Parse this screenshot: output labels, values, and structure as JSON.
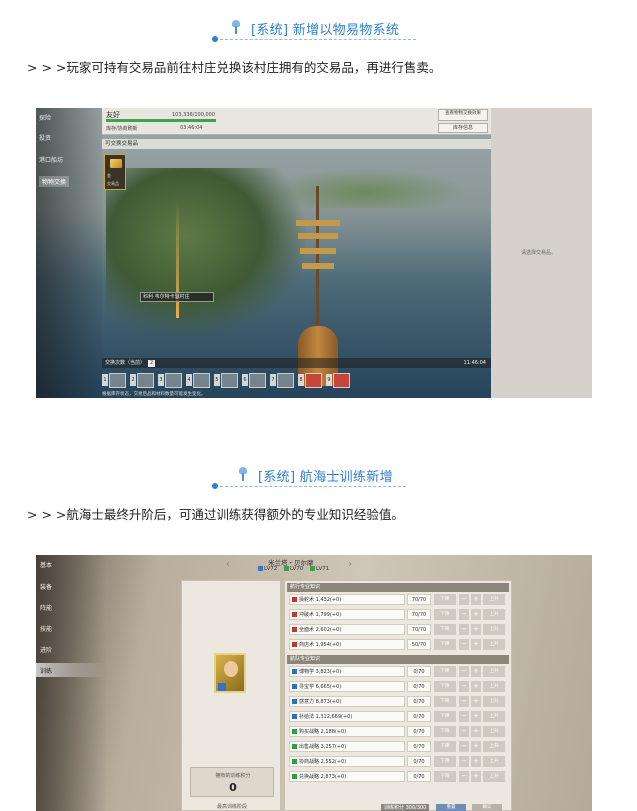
{
  "section1": {
    "title": "[系统] 新增以物易物系统",
    "description": "> > >玩家可持有交易品前往村庄兑换该村庄拥有的交易品，再进行售卖。",
    "screenshot": {
      "nav": [
        "探险",
        "投资",
        "港口船坊",
        "物物交换"
      ],
      "active_nav": "物物交换",
      "reputation_label": "友好",
      "reputation_value": "103,336/100,000",
      "reputation_fill": 1.0,
      "refresh_label": "库存/协商刷新",
      "refresh_time": "03:46:04",
      "btn_check": "查看物物交换效果",
      "btn_store": "库存信息",
      "subbar": "可交换交易品",
      "goods_line1": "金",
      "goods_line2": "交易品",
      "tooltip": "科利·韦尔特卡瑟村庄",
      "trade_count_label": "交换次数（当前）",
      "trade_count": "2",
      "trade_time": "11:46:04",
      "slot_numbers": [
        "1",
        "2",
        "3",
        "4",
        "5",
        "6",
        "7",
        "8",
        "9"
      ],
      "footer": "根据库存状态，交易后品和材料数量可能发生变化。",
      "right_text": "请选择交易品。"
    }
  },
  "section2": {
    "title": "[系统] 航海士训练新增",
    "description": "> > >航海士最终升阶后，可通过训练获得额外的专业知识经验值。",
    "screenshot": {
      "nav": [
        "基本",
        "装备",
        "阵能",
        "技能",
        "进阶",
        "训练"
      ],
      "active_nav": "训练",
      "name": "米兰塔・贝尔摩",
      "levels": [
        "LV72",
        "LV70",
        "LV71"
      ],
      "group1": "航行专业知识",
      "group2": "航队专业知识",
      "skills": [
        {
          "name": "操舵术 1,432(+0)",
          "level": "70/70",
          "color": "#c0392b"
        },
        {
          "name": "冲破术 1,799(+0)",
          "level": "70/70",
          "color": "#c0392b"
        },
        {
          "name": "全面术 2,602(+0)",
          "level": "70/70",
          "color": "#c0392b"
        },
        {
          "name": "商店术 1,954(+0)",
          "level": "50/70",
          "color": "#c0392b"
        },
        {
          "name": "博物学 3,823(+0)",
          "level": "0/70",
          "color": "#2e6fc2"
        },
        {
          "name": "寻宝学 6,665(+0)",
          "level": "0/70",
          "color": "#2e6fc2"
        },
        {
          "name": "感意力 8,873(+0)",
          "level": "0/70",
          "color": "#2e6fc2"
        },
        {
          "name": "补给法 1,312,669(+0)",
          "level": "0/70",
          "color": "#2e6fc2"
        },
        {
          "name": "购买战略 2,188(+0)",
          "level": "0/70",
          "color": "#2e9e49"
        },
        {
          "name": "出售战略 3,257(+0)",
          "level": "0/70",
          "color": "#2e9e49"
        },
        {
          "name": "协商战略 2,552(+0)",
          "level": "0/70",
          "color": "#2e9e49"
        },
        {
          "name": "兑换战略 2,873(+0)",
          "level": "0/70",
          "color": "#2e9e49"
        }
      ],
      "btn_left": "下降",
      "btn_right": "上升",
      "points_label": "拥有的训练积分",
      "points_value": "0",
      "stage_label": "最高训练阶段",
      "bottom_text": "训练积分 300/300",
      "reset": "重置",
      "confirm": "确认"
    }
  }
}
